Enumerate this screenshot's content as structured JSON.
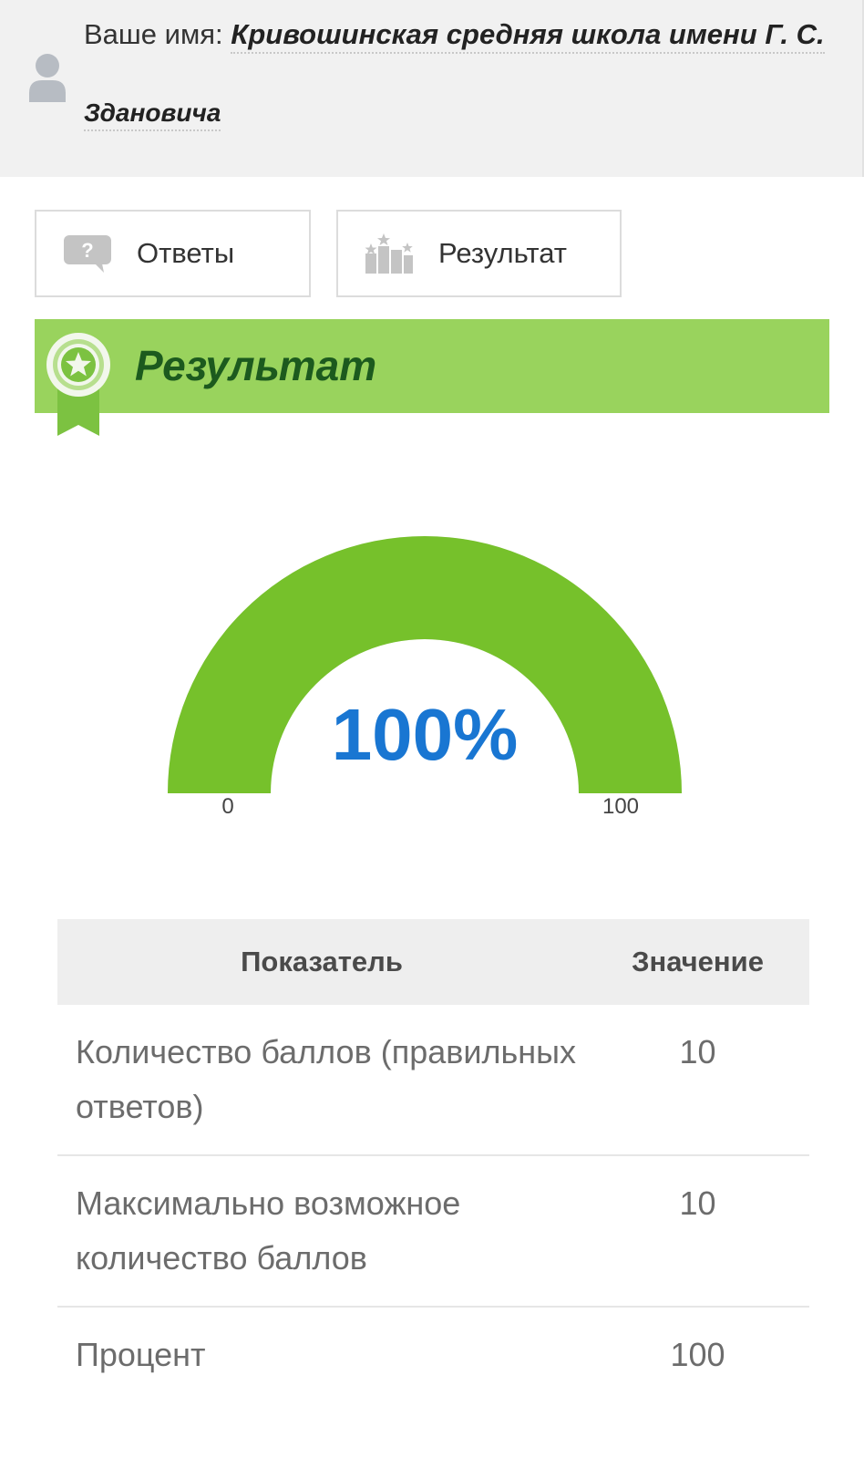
{
  "user": {
    "label": "Ваше имя:",
    "name_line1": "Кривошинская средняя школа имени Г. С.",
    "name_line2": "Здановича",
    "icon": "user-icon"
  },
  "tabs": [
    {
      "label": "Ответы",
      "icon": "question-bubble-icon"
    },
    {
      "label": "Результат",
      "icon": "podium-stars-icon"
    }
  ],
  "result_header": {
    "title": "Результат",
    "icon": "award-ribbon-icon",
    "color": "#99d35d",
    "title_color": "#1c5a1e"
  },
  "gauge": {
    "value": 100,
    "value_label": "100%",
    "min_label": "0",
    "max_label": "100",
    "min": 0,
    "max": 100,
    "fill_color": "#76c12b",
    "value_color": "#1976d2"
  },
  "table": {
    "headers": [
      "Показатель",
      "Значение"
    ],
    "rows": [
      {
        "indicator": "Количество баллов (правильных ответов)",
        "value": "10"
      },
      {
        "indicator": "Максимально возможное количество баллов",
        "value": "10"
      },
      {
        "indicator": "Процент",
        "value": "100"
      }
    ]
  }
}
